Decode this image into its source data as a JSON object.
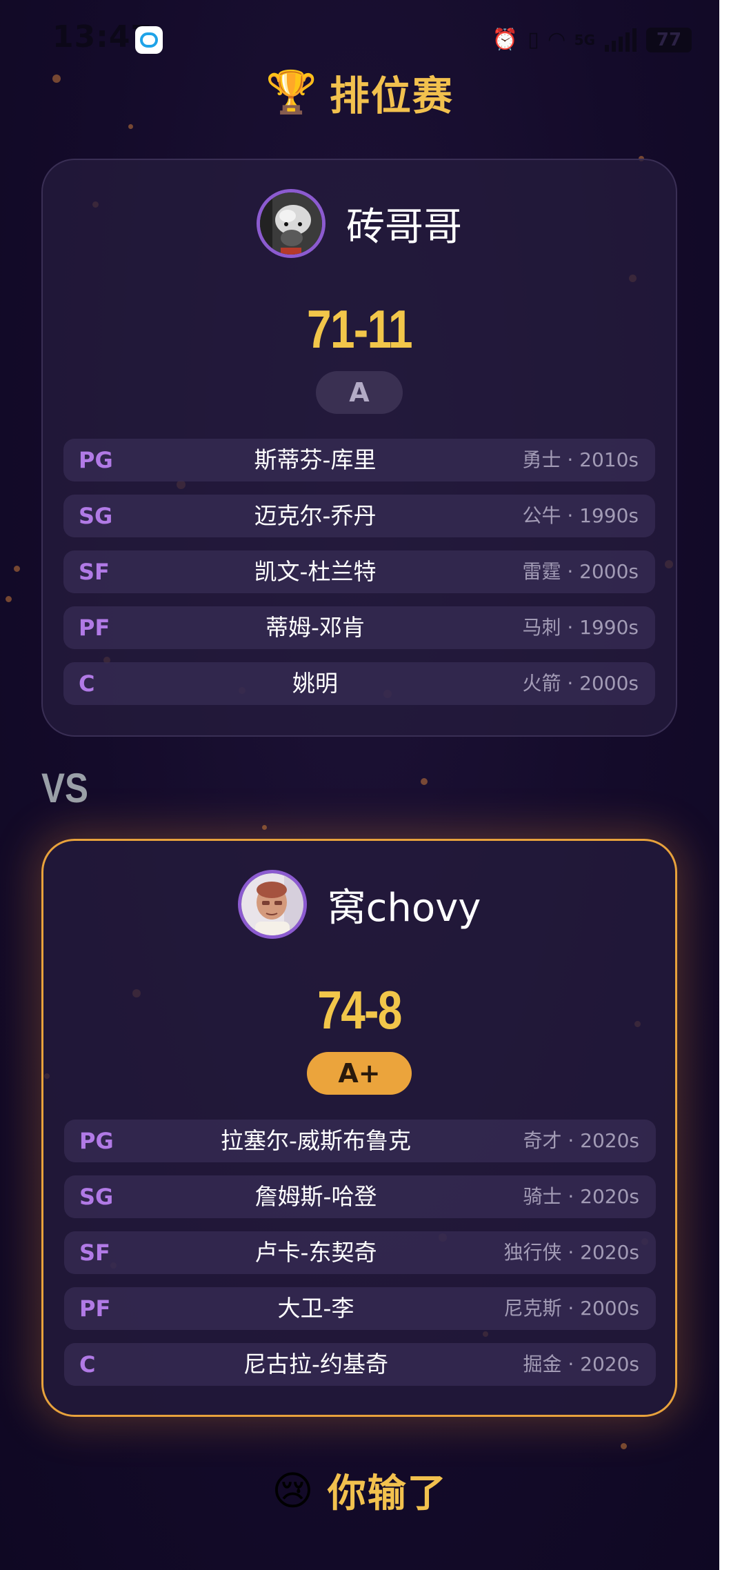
{
  "status_bar": {
    "time": "13:47",
    "network": "5G",
    "battery": "77"
  },
  "title": {
    "icon": "🏆",
    "text": "排位赛"
  },
  "opponent": {
    "name": "砖哥哥",
    "record": "71-11",
    "grade": "A",
    "roster": [
      {
        "pos": "PG",
        "name": "斯蒂芬-库里",
        "meta": "勇士 · 2010s"
      },
      {
        "pos": "SG",
        "name": "迈克尔-乔丹",
        "meta": "公牛 · 1990s"
      },
      {
        "pos": "SF",
        "name": "凯文-杜兰特",
        "meta": "雷霆 · 2000s"
      },
      {
        "pos": "PF",
        "name": "蒂姆-邓肯",
        "meta": "马刺 · 1990s"
      },
      {
        "pos": "C",
        "name": "姚明",
        "meta": "火箭 · 2000s"
      }
    ]
  },
  "vs_label": "VS",
  "player": {
    "name": "窝chovy",
    "record": "74-8",
    "grade": "A+",
    "roster": [
      {
        "pos": "PG",
        "name": "拉塞尔-威斯布鲁克",
        "meta": "奇才 · 2020s"
      },
      {
        "pos": "SG",
        "name": "詹姆斯-哈登",
        "meta": "骑士 · 2020s"
      },
      {
        "pos": "SF",
        "name": "卢卡-东契奇",
        "meta": "独行侠 · 2020s"
      },
      {
        "pos": "PF",
        "name": "大卫-李",
        "meta": "尼克斯 · 2000s"
      },
      {
        "pos": "C",
        "name": "尼古拉-约基奇",
        "meta": "掘金 · 2020s"
      }
    ]
  },
  "result": {
    "icon": "😢",
    "text": "你输了"
  },
  "colors": {
    "accent_gold": "#f2c14e",
    "position_purple": "#b17ae6",
    "winner_border": "#e8a23c",
    "background": "#140b2a"
  }
}
